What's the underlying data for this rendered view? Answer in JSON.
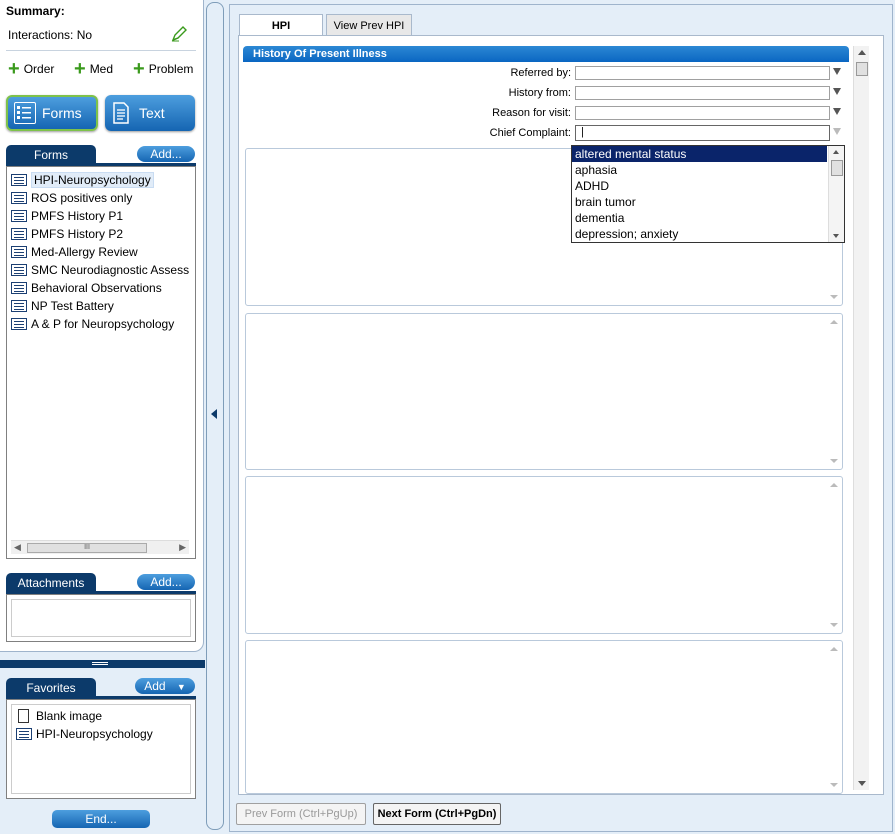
{
  "summary": {
    "title": "Summary:",
    "interactions": "Interactions: No"
  },
  "quick_actions": [
    {
      "label": "Order"
    },
    {
      "label": "Med"
    },
    {
      "label": "Problem"
    }
  ],
  "mode_buttons": {
    "forms": "Forms",
    "text": "Text"
  },
  "forms_panel": {
    "tab": "Forms",
    "add": "Add...",
    "items": [
      "HPI-Neuropsychology",
      "ROS positives only",
      "PMFS History P1",
      "PMFS History P2",
      "Med-Allergy Review",
      "SMC Neurodiagnostic Assess",
      "Behavioral Observations",
      "NP Test Battery",
      "A & P for Neuropsychology"
    ],
    "scroll_thumb": "III"
  },
  "attachments_panel": {
    "tab": "Attachments",
    "add": "Add..."
  },
  "favorites_panel": {
    "tab": "Favorites",
    "add": "Add",
    "items": [
      "Blank image",
      "HPI-Neuropsychology"
    ]
  },
  "end_button": "End...",
  "tabs": {
    "hpi": "HPI",
    "view_prev": "View Prev HPI"
  },
  "hpi": {
    "header": "History Of Present Illness",
    "fields": {
      "referred_by": "Referred by:",
      "history_from": "History from:",
      "reason": "Reason for visit:",
      "chief_complaint": "Chief Complaint:"
    },
    "chief_complaint_value": "|",
    "complaint_options": [
      "altered mental status",
      "aphasia",
      "ADHD",
      "brain tumor",
      "dementia",
      "depression; anxiety"
    ]
  },
  "nav": {
    "prev": "Prev Form (Ctrl+PgUp)",
    "next": "Next Form (Ctrl+PgDn)"
  },
  "colors": {
    "accent": "#1565b2",
    "dark_tab": "#0c3a6a",
    "plus": "#3a9a1c",
    "selection": "#0a246a"
  }
}
